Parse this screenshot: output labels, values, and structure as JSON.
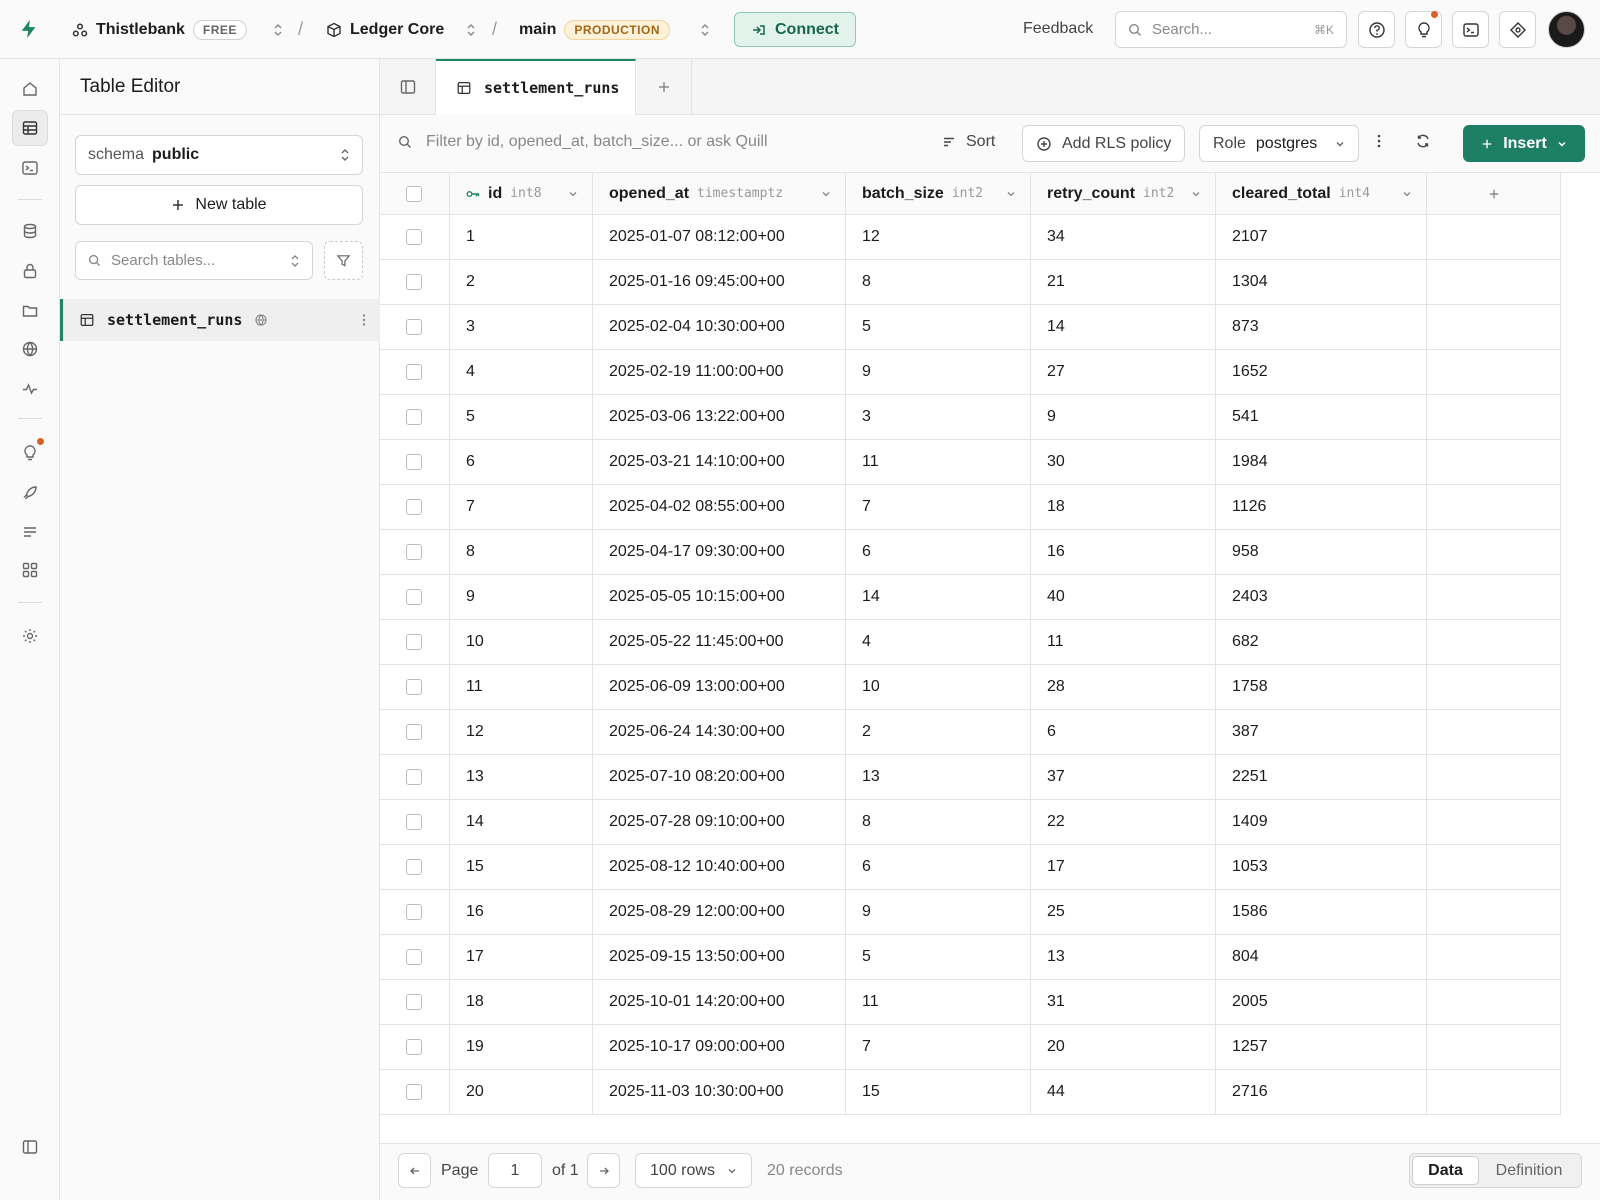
{
  "org": {
    "name": "Thistlebank",
    "plan": "FREE"
  },
  "project": {
    "name": "Ledger Core"
  },
  "branch": {
    "name": "main",
    "env": "PRODUCTION"
  },
  "topbar": {
    "connect_label": "Connect",
    "feedback_label": "Feedback",
    "search_placeholder": "Search...",
    "search_kbd": "⌘K"
  },
  "sidebar": {
    "title": "Table Editor",
    "schema_label": "schema",
    "schema_value": "public",
    "new_table_label": "New table",
    "search_placeholder": "Search tables...",
    "tables": [
      {
        "name": "settlement_runs"
      }
    ]
  },
  "tabs": [
    {
      "label": "settlement_runs"
    }
  ],
  "toolbar": {
    "filter_placeholder": "Filter by id, opened_at, batch_size... or ask Quill",
    "sort_label": "Sort",
    "rls_label": "Add RLS policy",
    "role_label": "Role",
    "role_value": "postgres",
    "insert_label": "Insert"
  },
  "columns": [
    {
      "name": "id",
      "type": "int8",
      "key": true
    },
    {
      "name": "opened_at",
      "type": "timestamptz"
    },
    {
      "name": "batch_size",
      "type": "int2"
    },
    {
      "name": "retry_count",
      "type": "int2"
    },
    {
      "name": "cleared_total",
      "type": "int4"
    }
  ],
  "rows": [
    [
      "1",
      "2025-01-07 08:12:00+00",
      "12",
      "34",
      "2107"
    ],
    [
      "2",
      "2025-01-16 09:45:00+00",
      "8",
      "21",
      "1304"
    ],
    [
      "3",
      "2025-02-04 10:30:00+00",
      "5",
      "14",
      "873"
    ],
    [
      "4",
      "2025-02-19 11:00:00+00",
      "9",
      "27",
      "1652"
    ],
    [
      "5",
      "2025-03-06 13:22:00+00",
      "3",
      "9",
      "541"
    ],
    [
      "6",
      "2025-03-21 14:10:00+00",
      "11",
      "30",
      "1984"
    ],
    [
      "7",
      "2025-04-02 08:55:00+00",
      "7",
      "18",
      "1126"
    ],
    [
      "8",
      "2025-04-17 09:30:00+00",
      "6",
      "16",
      "958"
    ],
    [
      "9",
      "2025-05-05 10:15:00+00",
      "14",
      "40",
      "2403"
    ],
    [
      "10",
      "2025-05-22 11:45:00+00",
      "4",
      "11",
      "682"
    ],
    [
      "11",
      "2025-06-09 13:00:00+00",
      "10",
      "28",
      "1758"
    ],
    [
      "12",
      "2025-06-24 14:30:00+00",
      "2",
      "6",
      "387"
    ],
    [
      "13",
      "2025-07-10 08:20:00+00",
      "13",
      "37",
      "2251"
    ],
    [
      "14",
      "2025-07-28 09:10:00+00",
      "8",
      "22",
      "1409"
    ],
    [
      "15",
      "2025-08-12 10:40:00+00",
      "6",
      "17",
      "1053"
    ],
    [
      "16",
      "2025-08-29 12:00:00+00",
      "9",
      "25",
      "1586"
    ],
    [
      "17",
      "2025-09-15 13:50:00+00",
      "5",
      "13",
      "804"
    ],
    [
      "18",
      "2025-10-01 14:20:00+00",
      "11",
      "31",
      "2005"
    ],
    [
      "19",
      "2025-10-17 09:00:00+00",
      "7",
      "20",
      "1257"
    ],
    [
      "20",
      "2025-11-03 10:30:00+00",
      "15",
      "44",
      "2716"
    ]
  ],
  "footer": {
    "page_label": "Page",
    "page_value": "1",
    "of_label": "of 1",
    "rows_label": "100 rows",
    "records_label": "20 records",
    "view_data": "Data",
    "view_definition": "Definition"
  },
  "colors": {
    "accent": "#1e7f67",
    "notification": "#d8612a"
  }
}
